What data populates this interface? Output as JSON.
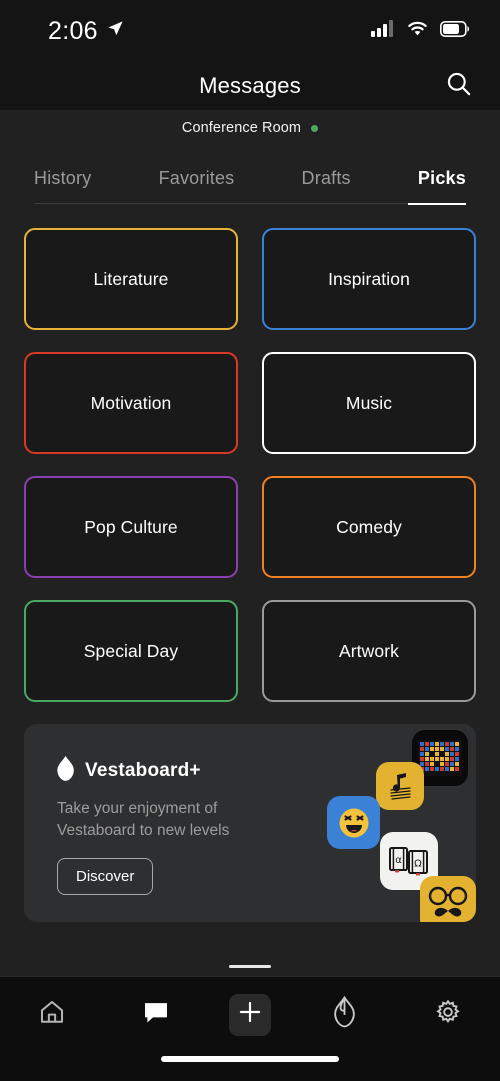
{
  "status_bar": {
    "time": "2:06",
    "location_icon": "location-arrow-icon",
    "signal_icon": "cellular-signal-icon",
    "wifi_icon": "wifi-icon",
    "battery_icon": "battery-icon",
    "battery_level_pct": 68
  },
  "header": {
    "title": "Messages",
    "search_icon": "search-icon"
  },
  "board": {
    "name": "Conference Room",
    "status_color": "#4ba860"
  },
  "tabs": [
    {
      "label": "History",
      "active": false
    },
    {
      "label": "Favorites",
      "active": false
    },
    {
      "label": "Drafts",
      "active": false
    },
    {
      "label": "Picks",
      "active": true
    }
  ],
  "categories": [
    {
      "label": "Literature",
      "color": "#e8b339"
    },
    {
      "label": "Inspiration",
      "color": "#3b82d6"
    },
    {
      "label": "Motivation",
      "color": "#d83a27"
    },
    {
      "label": "Music",
      "color": "#ffffff"
    },
    {
      "label": "Pop Culture",
      "color": "#8b3fb0"
    },
    {
      "label": "Comedy",
      "color": "#ef8023"
    },
    {
      "label": "Special Day",
      "color": "#4ba860"
    },
    {
      "label": "Artwork",
      "color": "#9b9b9b"
    }
  ],
  "promo": {
    "logo_icon": "vestaboard-flame-icon",
    "brand": "Vestaboard+",
    "description": "Take your enjoyment of Vestaboard to new levels",
    "button_label": "Discover",
    "tiles": [
      {
        "name": "pixel-board-tile",
        "bg": "#0a0a0a"
      },
      {
        "name": "music-note-tile",
        "bg": "#e3b231"
      },
      {
        "name": "laughing-face-tile",
        "bg": "#3b82d6"
      },
      {
        "name": "books-tile",
        "bg": "#f2f2f0"
      },
      {
        "name": "mustache-glasses-tile",
        "bg": "#e3b231"
      }
    ]
  },
  "bottom_nav": [
    {
      "name": "home-icon",
      "active": false
    },
    {
      "name": "messages-icon",
      "active": true
    },
    {
      "name": "plus-icon",
      "active": false
    },
    {
      "name": "vestaboard-flame-icon",
      "active": false
    },
    {
      "name": "gear-icon",
      "active": false
    }
  ]
}
